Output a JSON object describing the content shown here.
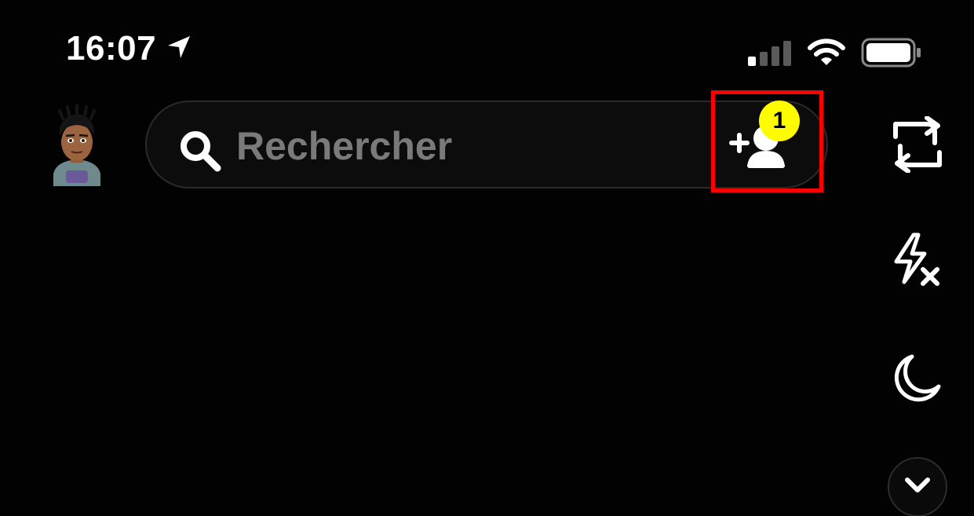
{
  "status_bar": {
    "time": "16:07",
    "location_icon": "location-arrow-icon",
    "signal_icon": "cellular-signal-icon",
    "wifi_icon": "wifi-icon",
    "battery_icon": "battery-icon"
  },
  "header": {
    "avatar_icon": "bitmoji-avatar",
    "search": {
      "icon": "search-icon",
      "placeholder": "Rechercher"
    },
    "add_friend": {
      "icon": "add-friend-icon",
      "badge_count": "1",
      "badge_color": "#fffc00",
      "highlight_color": "#ff0000"
    }
  },
  "camera_tools": {
    "flip_camera_icon": "flip-camera-icon",
    "flash_icon": "flash-off-icon",
    "night_mode_icon": "moon-icon",
    "more_icon": "chevron-down-icon"
  }
}
